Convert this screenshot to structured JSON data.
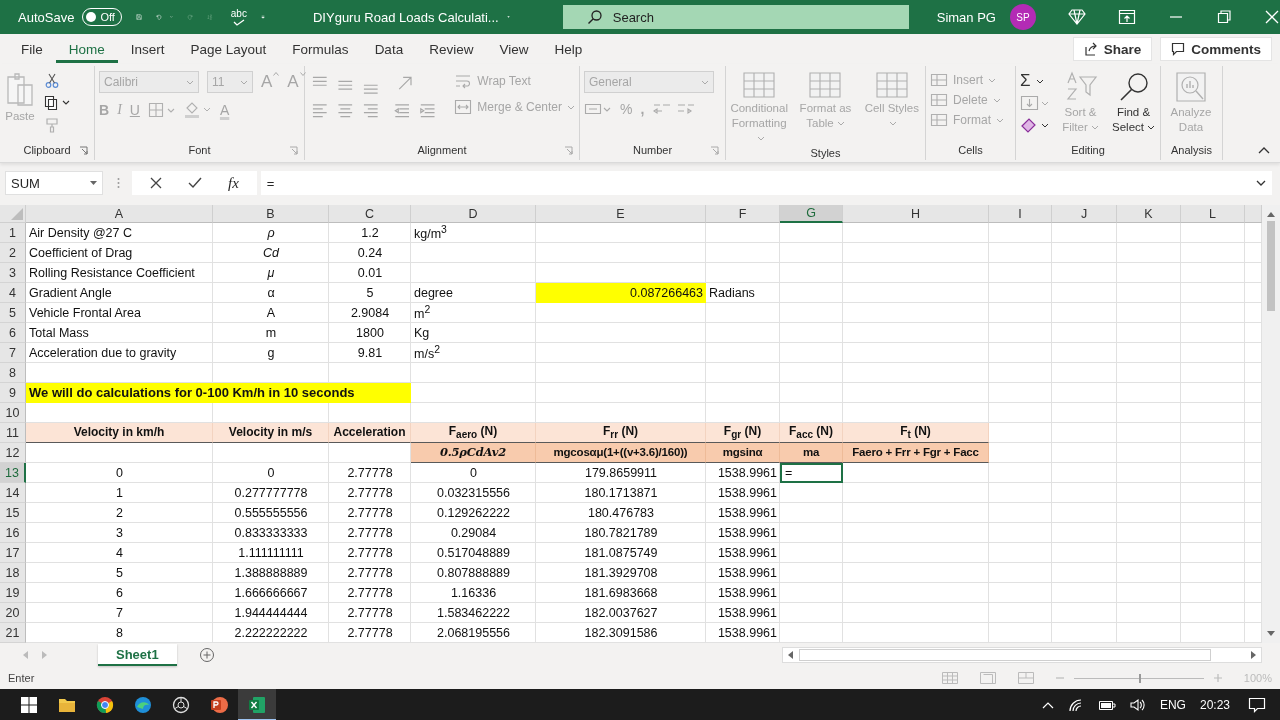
{
  "title_bar": {
    "autosave_label": "AutoSave",
    "autosave_state": "Off",
    "autosave_on": false,
    "spelling_glyph": "abc",
    "document_title": "DIYguru Road Loads Calculati...",
    "search_placeholder": "Search",
    "user_name": "Siman PG",
    "user_initials": "SP"
  },
  "ribbon_tabs": [
    {
      "label": "File",
      "selected": false
    },
    {
      "label": "Home",
      "selected": true
    },
    {
      "label": "Insert",
      "selected": false
    },
    {
      "label": "Page Layout",
      "selected": false
    },
    {
      "label": "Formulas",
      "selected": false
    },
    {
      "label": "Data",
      "selected": false
    },
    {
      "label": "Review",
      "selected": false
    },
    {
      "label": "View",
      "selected": false
    },
    {
      "label": "Help",
      "selected": false
    }
  ],
  "share_button": "Share",
  "comments_button": "Comments",
  "ribbon": {
    "clipboard": {
      "label": "Clipboard",
      "paste": {
        "label": "Paste",
        "disabled": true
      }
    },
    "font": {
      "label": "Font",
      "disabled": true,
      "font_name": "Calibri",
      "font_size": "11",
      "grow": "A",
      "shrink": "A",
      "bold": "B",
      "italic": "I",
      "underline": "U",
      "font_color": "A"
    },
    "alignment": {
      "label": "Alignment",
      "disabled": true,
      "wrap_text": "Wrap Text",
      "merge_center": "Merge & Center"
    },
    "number": {
      "label": "Number",
      "disabled": true,
      "format": "General",
      "percent": "%",
      "comma": ","
    },
    "styles": {
      "label": "Styles",
      "disabled": true,
      "items": [
        "Conditional Formatting",
        "Format as Table",
        "Cell Styles"
      ]
    },
    "cells": {
      "label": "Cells",
      "disabled": true,
      "items": [
        "Insert",
        "Delete",
        "Format"
      ]
    },
    "editing": {
      "label": "Editing",
      "autosum": {
        "label": "Σ",
        "disabled": false
      },
      "sort_filter": {
        "label": "Sort & Filter",
        "disabled": true
      },
      "find_select": {
        "label": "Find & Select",
        "disabled": false
      }
    },
    "analysis": {
      "label": "Analysis",
      "disabled": true,
      "analyze": "Analyze Data"
    }
  },
  "formula_bar": {
    "name_box": "SUM",
    "fx": "fx",
    "formula": "="
  },
  "columns": [
    {
      "label": "A",
      "selected": false
    },
    {
      "label": "B",
      "selected": false
    },
    {
      "label": "C",
      "selected": false
    },
    {
      "label": "D",
      "selected": false
    },
    {
      "label": "E",
      "selected": false
    },
    {
      "label": "F",
      "selected": false
    },
    {
      "label": "G",
      "selected": true
    },
    {
      "label": "H",
      "selected": false
    },
    {
      "label": "I",
      "selected": false
    },
    {
      "label": "J",
      "selected": false
    },
    {
      "label": "K",
      "selected": false
    },
    {
      "label": "L",
      "selected": false
    }
  ],
  "rows": [
    {
      "number": "1",
      "selected": false,
      "cells": [
        {
          "text": "Air Density @27 C",
          "kind": "left"
        },
        {
          "text": "ρ",
          "kind": "symbol"
        },
        {
          "text": "1.2",
          "kind": "center"
        },
        {
          "text": "kg/m$^{3}$",
          "kind": "left"
        }
      ]
    },
    {
      "number": "2",
      "selected": false,
      "cells": [
        {
          "text": "Coefficient of Drag",
          "kind": "left"
        },
        {
          "text": "Cd",
          "kind": "symbol"
        },
        {
          "text": "0.24",
          "kind": "center"
        }
      ]
    },
    {
      "number": "3",
      "selected": false,
      "cells": [
        {
          "text": "Rolling Resistance Coefficient",
          "kind": "left"
        },
        {
          "text": "μ",
          "kind": "symbol"
        },
        {
          "text": "0.01",
          "kind": "center"
        }
      ]
    },
    {
      "number": "4",
      "selected": false,
      "cells": [
        {
          "text": "Gradient Angle",
          "kind": "left"
        },
        {
          "text": "α",
          "kind": "center"
        },
        {
          "text": "5",
          "kind": "center"
        },
        {
          "text": "degree",
          "kind": "left"
        },
        {
          "text": "0.087266463",
          "kind": "highlight"
        },
        {
          "text": "Radians",
          "kind": "left"
        }
      ]
    },
    {
      "number": "5",
      "selected": false,
      "cells": [
        {
          "text": "Vehicle Frontal Area",
          "kind": "left"
        },
        {
          "text": "A",
          "kind": "center"
        },
        {
          "text": "2.9084",
          "kind": "center"
        },
        {
          "text": "m$^{2}$",
          "kind": "left"
        }
      ]
    },
    {
      "number": "6",
      "selected": false,
      "cells": [
        {
          "text": "Total Mass",
          "kind": "left"
        },
        {
          "text": "m",
          "kind": "center"
        },
        {
          "text": "1800",
          "kind": "center"
        },
        {
          "text": "Kg",
          "kind": "left"
        }
      ]
    },
    {
      "number": "7",
      "selected": false,
      "cells": [
        {
          "text": "Acceleration due to gravity",
          "kind": "left"
        },
        {
          "text": "g",
          "kind": "center"
        },
        {
          "text": "9.81",
          "kind": "center"
        },
        {
          "text": "m/s$^{2}$",
          "kind": "left"
        }
      ]
    },
    {
      "number": "8",
      "selected": false
    },
    {
      "number": "9",
      "selected": false,
      "cells": [
        {
          "text": "We will do calculations for 0-100 Km/h in 10 seconds",
          "kind": "banner"
        }
      ]
    },
    {
      "number": "10",
      "selected": false
    },
    {
      "number": "11",
      "selected": false,
      "cells": [
        {
          "text": "Velocity in km/h",
          "kind": "header"
        },
        {
          "text": "Velocity in m/s",
          "kind": "header"
        },
        {
          "text": "Acceleration",
          "kind": "header"
        },
        {
          "text": "F$_{aero}$ (N)",
          "kind": "header"
        },
        {
          "text": "F$_{rr}$ (N)",
          "kind": "header"
        },
        {
          "text": "F$_{gr}$ (N)",
          "kind": "header"
        },
        {
          "text": "F$_{acc}$ (N)",
          "kind": "header"
        },
        {
          "text": "F$_{t}$ (N)",
          "kind": "header"
        }
      ]
    },
    {
      "number": "12",
      "selected": false,
      "cells": [
        null,
        null,
        null,
        {
          "text": "0.5ρCdAv2",
          "kind": "math"
        },
        {
          "text": "mgcosαμ(1+((v+3.6)/160))",
          "kind": "subheader"
        },
        {
          "text": "mgsinα",
          "kind": "subheader"
        },
        {
          "text": "ma",
          "kind": "subheader"
        },
        {
          "text": "Faero + Frr + Fgr + Facc",
          "kind": "subheader"
        }
      ]
    },
    {
      "number": "13",
      "selected": true,
      "cells": [
        {
          "text": "0",
          "kind": "center"
        },
        {
          "text": "0",
          "kind": "center"
        },
        {
          "text": "2.77778",
          "kind": "center"
        },
        {
          "text": "0",
          "kind": "center"
        },
        {
          "text": "179.8659911",
          "kind": "center"
        },
        {
          "text": "1538.9961",
          "kind": "right"
        },
        {
          "text": "=",
          "kind": "active"
        }
      ]
    },
    {
      "number": "14",
      "selected": false,
      "cells": [
        {
          "text": "1",
          "kind": "center"
        },
        {
          "text": "0.277777778",
          "kind": "center"
        },
        {
          "text": "2.77778",
          "kind": "center"
        },
        {
          "text": "0.032315556",
          "kind": "center"
        },
        {
          "text": "180.1713871",
          "kind": "center"
        },
        {
          "text": "1538.9961",
          "kind": "right"
        }
      ]
    },
    {
      "number": "15",
      "selected": false,
      "cells": [
        {
          "text": "2",
          "kind": "center"
        },
        {
          "text": "0.555555556",
          "kind": "center"
        },
        {
          "text": "2.77778",
          "kind": "center"
        },
        {
          "text": "0.129262222",
          "kind": "center"
        },
        {
          "text": "180.476783",
          "kind": "center"
        },
        {
          "text": "1538.9961",
          "kind": "right"
        }
      ]
    },
    {
      "number": "16",
      "selected": false,
      "cells": [
        {
          "text": "3",
          "kind": "center"
        },
        {
          "text": "0.833333333",
          "kind": "center"
        },
        {
          "text": "2.77778",
          "kind": "center"
        },
        {
          "text": "0.29084",
          "kind": "center"
        },
        {
          "text": "180.7821789",
          "kind": "center"
        },
        {
          "text": "1538.9961",
          "kind": "right"
        }
      ]
    },
    {
      "number": "17",
      "selected": false,
      "cells": [
        {
          "text": "4",
          "kind": "center"
        },
        {
          "text": "1.111111111",
          "kind": "center"
        },
        {
          "text": "2.77778",
          "kind": "center"
        },
        {
          "text": "0.517048889",
          "kind": "center"
        },
        {
          "text": "181.0875749",
          "kind": "center"
        },
        {
          "text": "1538.9961",
          "kind": "right"
        }
      ]
    },
    {
      "number": "18",
      "selected": false,
      "cells": [
        {
          "text": "5",
          "kind": "center"
        },
        {
          "text": "1.388888889",
          "kind": "center"
        },
        {
          "text": "2.77778",
          "kind": "center"
        },
        {
          "text": "0.807888889",
          "kind": "center"
        },
        {
          "text": "181.3929708",
          "kind": "center"
        },
        {
          "text": "1538.9961",
          "kind": "right"
        }
      ]
    },
    {
      "number": "19",
      "selected": false,
      "cells": [
        {
          "text": "6",
          "kind": "center"
        },
        {
          "text": "1.666666667",
          "kind": "center"
        },
        {
          "text": "2.77778",
          "kind": "center"
        },
        {
          "text": "1.16336",
          "kind": "center"
        },
        {
          "text": "181.6983668",
          "kind": "center"
        },
        {
          "text": "1538.9961",
          "kind": "right"
        }
      ]
    },
    {
      "number": "20",
      "selected": false,
      "cells": [
        {
          "text": "7",
          "kind": "center"
        },
        {
          "text": "1.944444444",
          "kind": "center"
        },
        {
          "text": "2.77778",
          "kind": "center"
        },
        {
          "text": "1.583462222",
          "kind": "center"
        },
        {
          "text": "182.0037627",
          "kind": "center"
        },
        {
          "text": "1538.9961",
          "kind": "right"
        }
      ]
    },
    {
      "number": "21",
      "selected": false,
      "cells": [
        {
          "text": "8",
          "kind": "center"
        },
        {
          "text": "2.222222222",
          "kind": "center"
        },
        {
          "text": "2.77778",
          "kind": "center"
        },
        {
          "text": "2.068195556",
          "kind": "center"
        },
        {
          "text": "182.3091586",
          "kind": "center"
        },
        {
          "text": "1538.9961",
          "kind": "right"
        }
      ]
    }
  ],
  "sheet_tabs": [
    {
      "label": "Sheet1",
      "selected": true
    }
  ],
  "status_bar": {
    "mode": "Enter",
    "zoom_slider": {
      "level": 0.5
    },
    "zoom": "100%"
  },
  "taskbar": {
    "language": "ENG",
    "time": "20:23"
  }
}
